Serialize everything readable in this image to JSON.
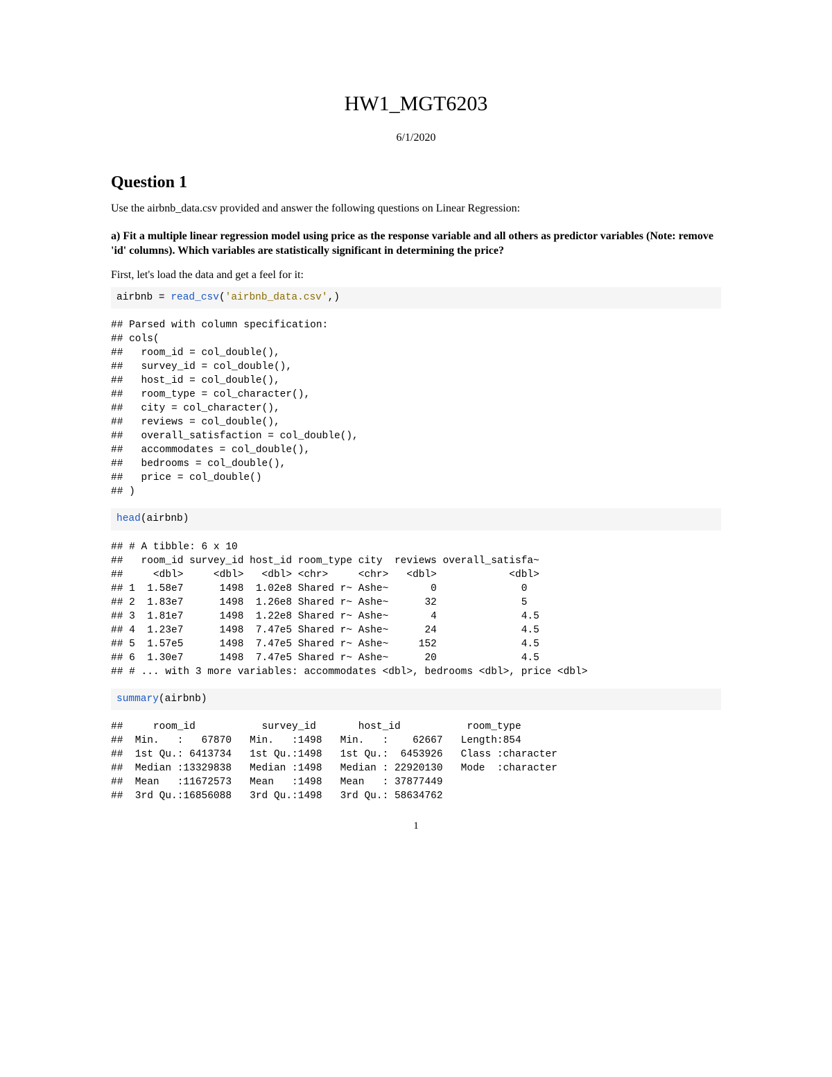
{
  "title": "HW1_MGT6203",
  "date": "6/1/2020",
  "section1_title": "Question 1",
  "intro_text": "Use the airbnb_data.csv provided and answer the following questions on Linear Regression:",
  "q1a_text": "a) Fit a multiple linear regression model using price as the response variable and all others as predictor variables (Note: remove 'id' columns). Which variables are statistically significant in determining the price?",
  "prompt_text": "First, let's load the data and get a feel for it:",
  "code1": {
    "prefix": "airbnb = ",
    "fn": "read_csv",
    "paren_open": "(",
    "arg": "'airbnb_data.csv'",
    "paren_close": ",)"
  },
  "output1": "## Parsed with column specification:\n## cols(\n##   room_id = col_double(),\n##   survey_id = col_double(),\n##   host_id = col_double(),\n##   room_type = col_character(),\n##   city = col_character(),\n##   reviews = col_double(),\n##   overall_satisfaction = col_double(),\n##   accommodates = col_double(),\n##   bedrooms = col_double(),\n##   price = col_double()\n## )",
  "code2": {
    "fn": "head",
    "paren_open": "(airbnb)",
    "paren_close": ""
  },
  "output2": "## # A tibble: 6 x 10\n##   room_id survey_id host_id room_type city  reviews overall_satisfa~\n##     <dbl>     <dbl>   <dbl> <chr>     <chr>   <dbl>            <dbl>\n## 1  1.58e7      1498  1.02e8 Shared r~ Ashe~       0              0  \n## 2  1.83e7      1498  1.26e8 Shared r~ Ashe~      32              5  \n## 3  1.81e7      1498  1.22e8 Shared r~ Ashe~       4              4.5\n## 4  1.23e7      1498  7.47e5 Shared r~ Ashe~      24              4.5\n## 5  1.57e5      1498  7.47e5 Shared r~ Ashe~     152              4.5\n## 6  1.30e7      1498  7.47e5 Shared r~ Ashe~      20              4.5\n## # ... with 3 more variables: accommodates <dbl>, bedrooms <dbl>, price <dbl>",
  "code3": {
    "fn": "summary",
    "paren_open": "(airbnb)",
    "paren_close": ""
  },
  "output3": "##     room_id           survey_id       host_id           room_type        \n##  Min.   :   67870   Min.   :1498   Min.   :    62667   Length:854        \n##  1st Qu.: 6413734   1st Qu.:1498   1st Qu.:  6453926   Class :character  \n##  Median :13329838   Median :1498   Median : 22920130   Mode  :character  \n##  Mean   :11672573   Mean   :1498   Mean   : 37877449                     \n##  3rd Qu.:16856088   3rd Qu.:1498   3rd Qu.: 58634762                     ",
  "page_number": "1"
}
